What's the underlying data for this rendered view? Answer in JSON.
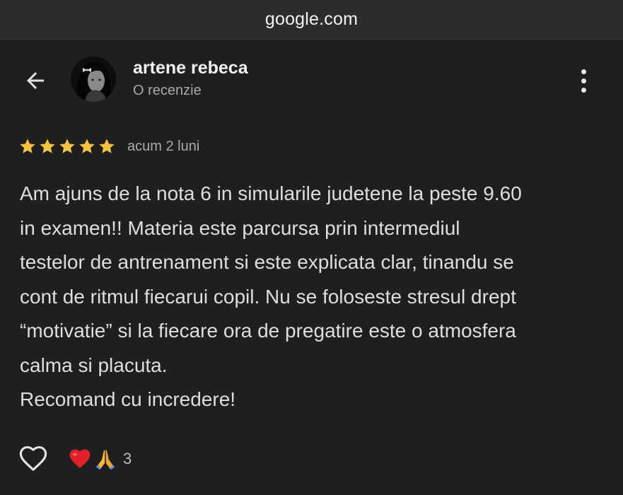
{
  "browser": {
    "url": "google.com"
  },
  "reviewer": {
    "name": "artene rebeca",
    "subtitle": "O recenzie"
  },
  "rating": {
    "stars": 5,
    "max": 5,
    "date": "acum 2 luni",
    "star_color": "#f5c242"
  },
  "review": {
    "text": "Am ajuns de la nota 6 in simularile judetene la peste 9.60\nin examen!! Materia este parcursa prin intermediul\ntestelor de antrenament si este explicata clar, tinandu se\ncont de ritmul fiecarui copil. Nu se foloseste stresul drept\n“motivatie” si la fiecare ora de pregatire este o atmosfera\ncalma si placuta.\nRecomand cu incredere!"
  },
  "actions": {
    "like_icon": "heart-outline-icon",
    "reactions": [
      "red-heart-emoji",
      "folded-hands-emoji"
    ],
    "reaction_count": "3"
  },
  "theme": {
    "background": "#1f1f1f",
    "urlbar": "#2b2c2e"
  }
}
